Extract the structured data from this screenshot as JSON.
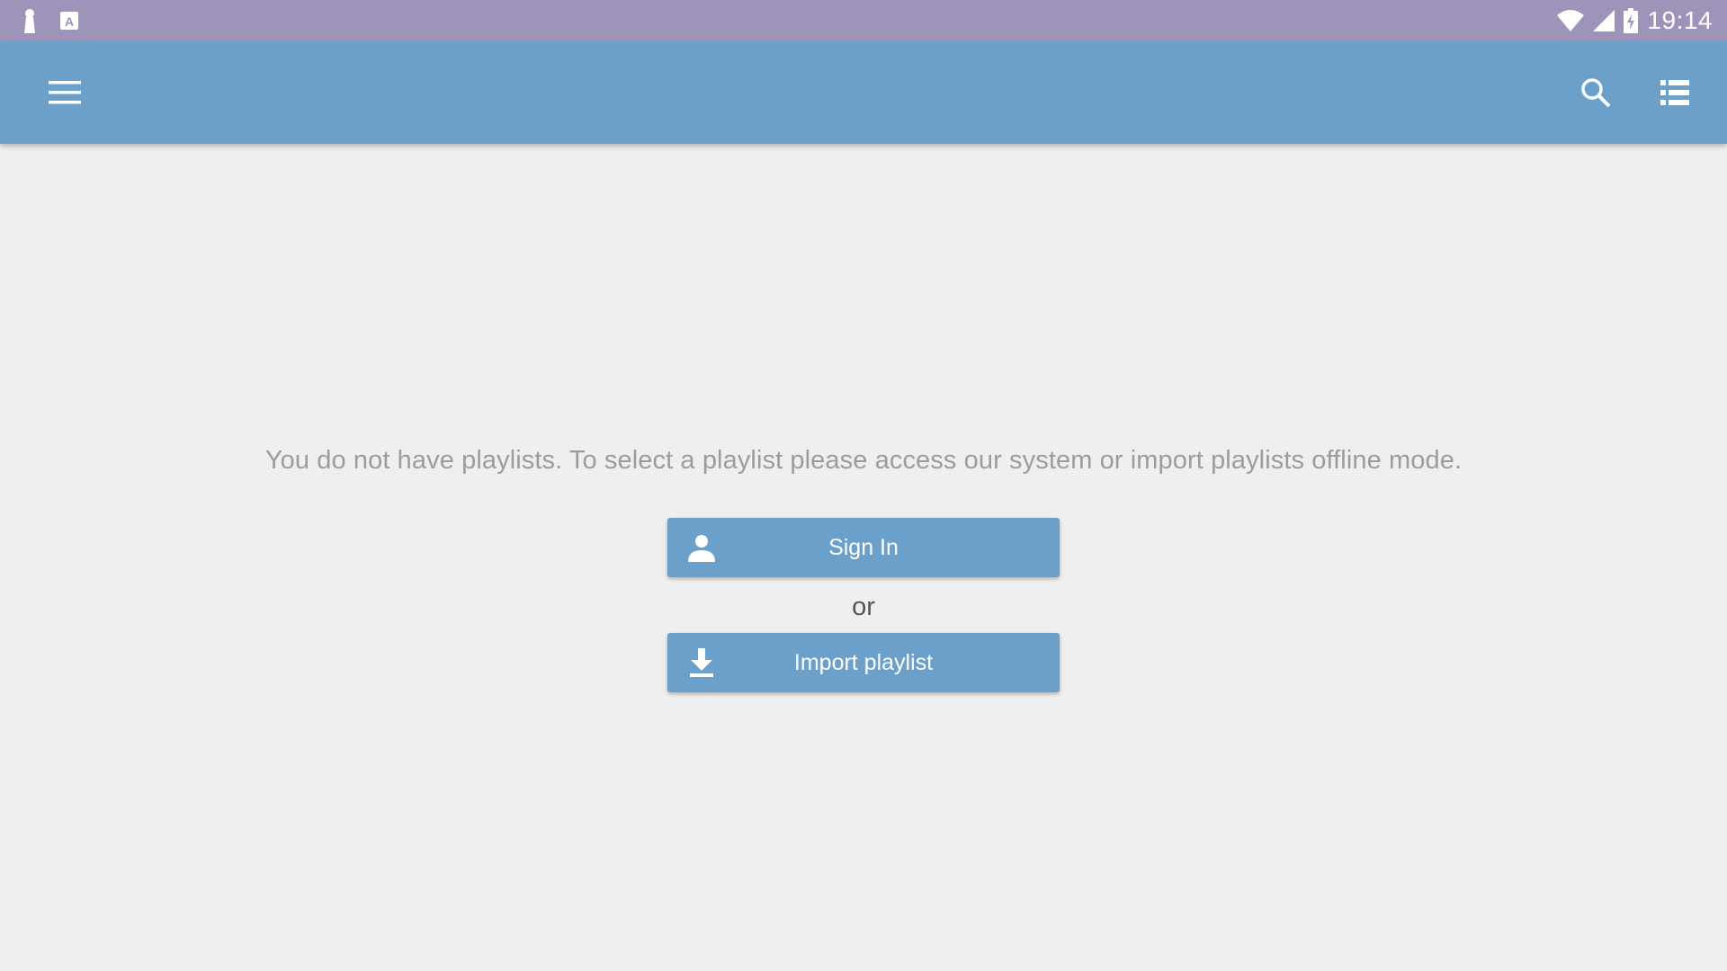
{
  "status_bar": {
    "time": "19:14",
    "left_icons": [
      "keyhole-icon",
      "keyboard-a-icon"
    ],
    "right_icons": [
      "wifi-icon",
      "cell-signal-icon",
      "battery-charging-icon"
    ]
  },
  "app_bar": {
    "menu_icon": "hamburger-menu-icon",
    "actions": [
      "search-icon",
      "list-view-icon"
    ]
  },
  "main": {
    "empty_message": "You do not have playlists. To select a playlist please access our system or import playlists offline mode.",
    "sign_in_label": "Sign In",
    "sign_in_icon": "person-icon",
    "or_label": "or",
    "import_label": "Import playlist",
    "import_icon": "download-icon"
  },
  "colors": {
    "status_bar": "#9e93b9",
    "app_bar": "#6aa0ca",
    "background": "#efefef",
    "button": "#6aa0ca",
    "message_text": "#9c9c9c"
  }
}
